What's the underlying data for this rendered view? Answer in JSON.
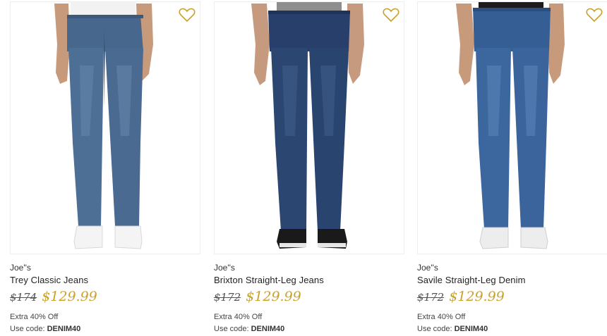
{
  "colors": {
    "accent": "#c9a227",
    "text": "#222222",
    "border": "#eeeeee"
  },
  "products": [
    {
      "brand": "Joe''s",
      "name": "Trey Classic Jeans",
      "original_price": "$174",
      "sale_price": "$129.99",
      "promo": "Extra 40% Off",
      "code_label": "Use code:",
      "code": "DENIM40",
      "icon": "heart-icon",
      "image": "model-in-light-wash-jeans-white-sneakers"
    },
    {
      "brand": "Joe''s",
      "name": "Brixton Straight-Leg Jeans",
      "original_price": "$172",
      "sale_price": "$129.99",
      "promo": "Extra 40% Off",
      "code_label": "Use code:",
      "code": "DENIM40",
      "icon": "heart-icon",
      "image": "model-in-dark-wash-jeans-black-sneakers"
    },
    {
      "brand": "Joe''s",
      "name": "Savile Straight-Leg Denim",
      "original_price": "$172",
      "sale_price": "$129.99",
      "promo": "Extra 40% Off",
      "code_label": "Use code:",
      "code": "DENIM40",
      "icon": "heart-icon",
      "image": "model-in-medium-wash-jeans-white-sneakers"
    }
  ]
}
